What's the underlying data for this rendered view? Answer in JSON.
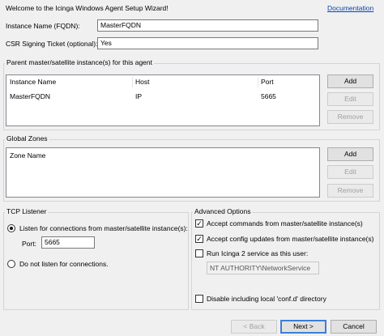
{
  "header": {
    "welcome": "Welcome to the Icinga Windows Agent Setup Wizard!",
    "documentation_link": "Documentation"
  },
  "instance_name": {
    "label": "Instance Name (FQDN):",
    "value": "MasterFQDN"
  },
  "csr_ticket": {
    "label": "CSR Signing Ticket (optional):",
    "value": "Yes"
  },
  "parents": {
    "title": "Parent master/satellite instance(s) for this agent",
    "columns": [
      "Instance Name",
      "Host",
      "Port"
    ],
    "rows": [
      {
        "instance": "MasterFQDN",
        "host": "IP",
        "port": "5665"
      }
    ],
    "buttons": {
      "add": "Add",
      "edit": "Edit",
      "remove": "Remove"
    }
  },
  "global_zones": {
    "title": "Global Zones",
    "columns": [
      "Zone Name"
    ],
    "buttons": {
      "add": "Add",
      "edit": "Edit",
      "remove": "Remove"
    }
  },
  "tcp": {
    "title": "TCP Listener",
    "listen_label": "Listen for connections from master/satellite instance(s):",
    "port_label": "Port:",
    "port_value": "5665",
    "no_listen_label": "Do not listen for connections.",
    "selected": "listen"
  },
  "advanced": {
    "title": "Advanced Options",
    "accept_commands": {
      "label": "Accept commands from master/satellite instance(s)",
      "checked": true
    },
    "accept_config": {
      "label": "Accept config updates from master/satellite instance(s)",
      "checked": true
    },
    "run_as": {
      "label": "Run Icinga 2 service as this user:",
      "checked": false,
      "value": "NT AUTHORITY\\NetworkService"
    },
    "disable_confd": {
      "label": "Disable including local 'conf.d' directory",
      "checked": false
    }
  },
  "footer": {
    "back": "< Back",
    "next": "Next >",
    "cancel": "Cancel"
  }
}
